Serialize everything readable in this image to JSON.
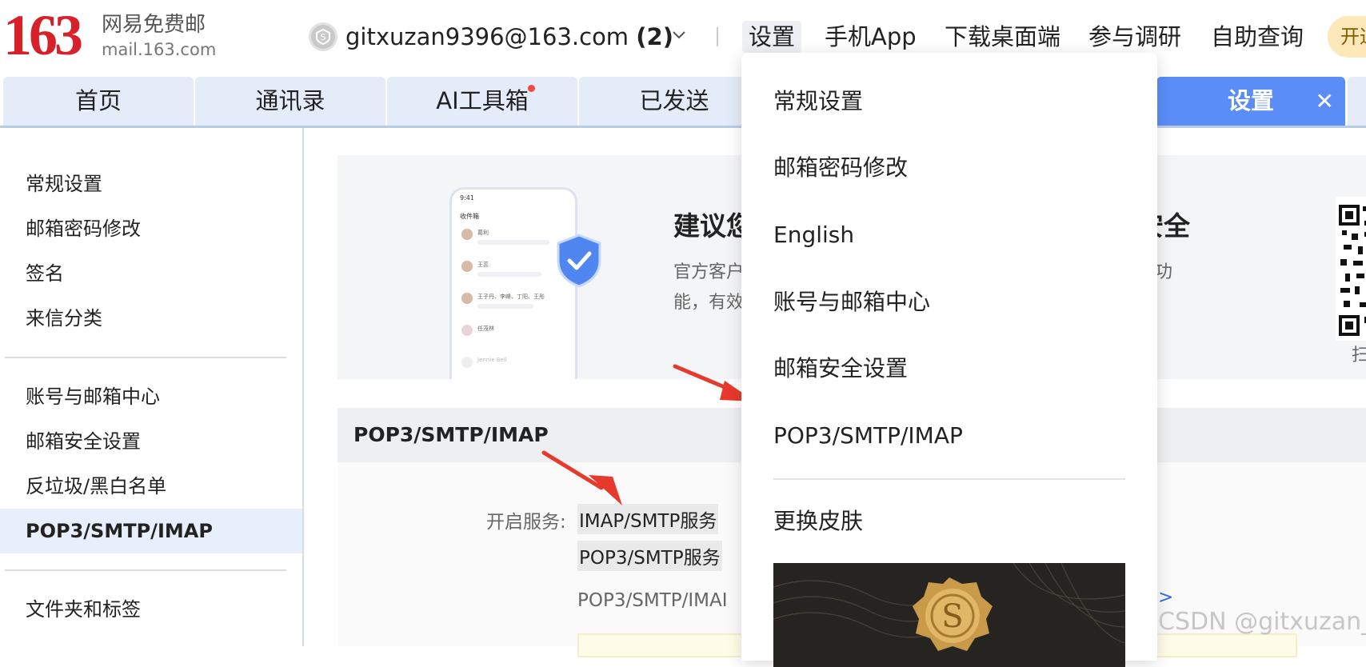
{
  "logo": {
    "number": "163",
    "cn": "网易免费邮",
    "domain": "mail.163.com"
  },
  "account": {
    "email": "gitxuzan9396@163.com",
    "count": "(2)"
  },
  "top_nav": [
    "设置",
    "手机App",
    "下载桌面端",
    "参与调研",
    "自助查询"
  ],
  "open_button": "开通",
  "tabs": [
    {
      "label": "首页"
    },
    {
      "label": "通讯录"
    },
    {
      "label": "AI工具箱"
    },
    {
      "label": "已发送"
    },
    {
      "label": "设置"
    }
  ],
  "tab_close": "✕",
  "sidebar": {
    "group1": [
      "常规设置",
      "邮箱密码修改",
      "签名",
      "来信分类"
    ],
    "group2": [
      "账号与邮箱中心",
      "邮箱安全设置",
      "反垃圾/黑白名单",
      "POP3/SMTP/IMAP"
    ],
    "group3": [
      "文件夹和标签"
    ]
  },
  "promo": {
    "title_left": "建议您",
    "title_right": "安全",
    "desc_left_1": "官方客户",
    "desc_left_2": "能，有效",
    "desc_right_1": "障功",
    "qr_caption": "扫"
  },
  "phone": {
    "time": "9:41",
    "folder": "收件箱",
    "rows": [
      "葛利",
      "王蕊",
      "王子丹、李峰、丁阳、王彤",
      "任茂林",
      "Jennie Bell"
    ]
  },
  "section": {
    "title": "POP3/SMTP/IMAP",
    "service_label": "开启服务:",
    "services": [
      "IMAP/SMTP服务",
      "POP3/SMTP服务"
    ],
    "note": "POP3/SMTP/IMAI",
    "link": ">"
  },
  "dropdown": {
    "items": [
      "常规设置",
      "邮箱密码修改",
      "English",
      "账号与邮箱中心",
      "邮箱安全设置",
      "POP3/SMTP/IMAP",
      "更换皮肤"
    ]
  },
  "watermark": "CSDN @gitxuzan_",
  "colors": {
    "brand_red": "#d8202a",
    "tab_blue": "#5b8df7",
    "tab_bg": "#e5ecf9",
    "arrow_red": "#e8392d"
  }
}
